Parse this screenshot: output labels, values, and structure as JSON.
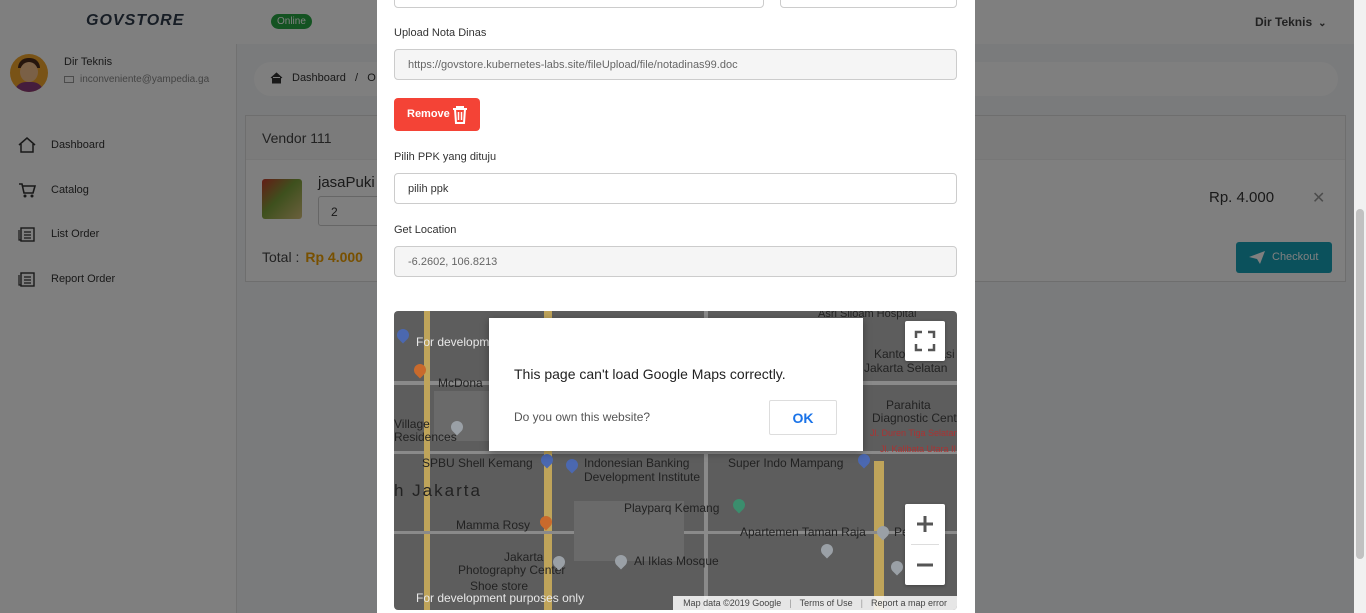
{
  "app": {
    "brand": "GOVSTORE",
    "status_badge": "Online",
    "user_menu": "Dir Teknis"
  },
  "profile": {
    "name": "Dir Teknis",
    "email": "inconveniente@yampedia.ga"
  },
  "sidebar": {
    "items": [
      {
        "label": "Dashboard",
        "icon": "home-icon"
      },
      {
        "label": "Catalog",
        "icon": "cart-icon"
      },
      {
        "label": "List Order",
        "icon": "list-icon"
      },
      {
        "label": "Report Order",
        "icon": "report-icon"
      }
    ]
  },
  "breadcrumb": {
    "home": "Dashboard",
    "separator": "/",
    "current": "O"
  },
  "cart": {
    "vendor": "Vendor 111",
    "product_name": "jasaPuki",
    "quantity": "2",
    "price": "Rp. 4.000",
    "total_label": "Total :",
    "total_value": "Rp 4.000",
    "checkout_label": "Checkout"
  },
  "modal": {
    "upload_label": "Upload Nota Dinas",
    "upload_value": "https://govstore.kubernetes-labs.site/fileUpload/file/notadinas99.doc",
    "remove_label": "Remove",
    "ppk_label": "Pilih PPK yang dituju",
    "ppk_value": "pilih ppk",
    "location_label": "Get Location",
    "location_value": "-6.2602, 106.8213"
  },
  "map": {
    "dev_watermark_top": "For development purposes only",
    "dev_watermark_bottom": "For development purposes only",
    "places": {
      "hospital": "Asri Siloam Hospital",
      "imigrasi": "Kantor Imigrasi",
      "jakarta_selatan": "Jakarta Selatan",
      "mcdonalds": "McDona",
      "village": "Village",
      "residences": "Residences",
      "parahita": "Parahita",
      "diagnostic": "Diagnostic Center",
      "duren": "Jl. Duren Tiga Selatan",
      "spbu": "SPBU Shell Kemang",
      "banking": "Indonesian Banking",
      "institute": "Development Institute",
      "superindo": "Super Indo Mampang",
      "kalibata": "Jl. Kalibata Utara II",
      "jakarta": "h Jakarta",
      "mamma": "Mamma Rosy",
      "playparq": "Playparq Kemang",
      "apartemen": "Apartemen Taman Raja",
      "jakarta_photo": "Jakarta",
      "photography": "Photography Center",
      "shoe": "Shoe store",
      "alikhlas": "Al Iklas Mosque",
      "pe": "Pe"
    },
    "footer": {
      "mapdata": "Map data ©2019 Google",
      "terms": "Terms of Use",
      "report": "Report a map error"
    }
  },
  "dialog": {
    "message": "This page can't load Google Maps correctly.",
    "question": "Do you own this website?",
    "ok_label": "OK"
  },
  "colors": {
    "accent": "#17a2b8",
    "danger": "#f44336",
    "online": "#28a745",
    "total": "#f0a000"
  }
}
